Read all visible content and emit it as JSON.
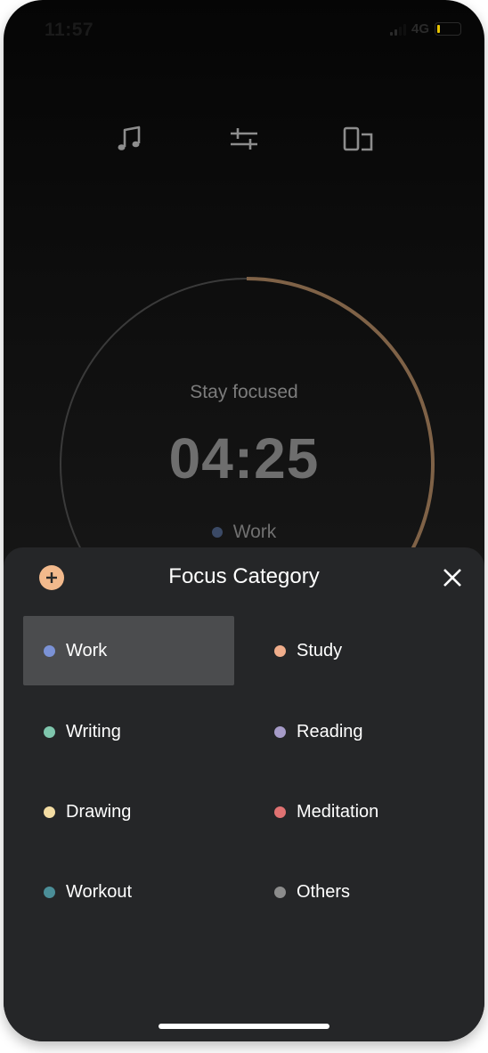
{
  "status_bar": {
    "time": "11:57",
    "network": "4G"
  },
  "toolbar": {
    "icons": [
      "music-note-icon",
      "sliders-icon",
      "devices-icon"
    ]
  },
  "timer": {
    "caption": "Stay focused",
    "time_remaining": "04:25",
    "category": "Work",
    "category_color": "#3b4a66",
    "progress_fraction": 0.44,
    "progress_color": "#7f6247",
    "track_color": "#3a3a3a"
  },
  "sheet": {
    "title": "Focus Category",
    "add_icon": "plus-circle-icon",
    "close_icon": "close-icon",
    "accent_color": "#f2b98c",
    "categories": [
      {
        "label": "Work",
        "color": "#7b92d6",
        "selected": true
      },
      {
        "label": "Study",
        "color": "#f0ad8b",
        "selected": false
      },
      {
        "label": "Writing",
        "color": "#7fc6ad",
        "selected": false
      },
      {
        "label": "Reading",
        "color": "#a69bc8",
        "selected": false
      },
      {
        "label": "Drawing",
        "color": "#f3dca3",
        "selected": false
      },
      {
        "label": "Meditation",
        "color": "#e07272",
        "selected": false
      },
      {
        "label": "Workout",
        "color": "#4b8e98",
        "selected": false
      },
      {
        "label": "Others",
        "color": "#8c8c8c",
        "selected": false
      }
    ]
  }
}
